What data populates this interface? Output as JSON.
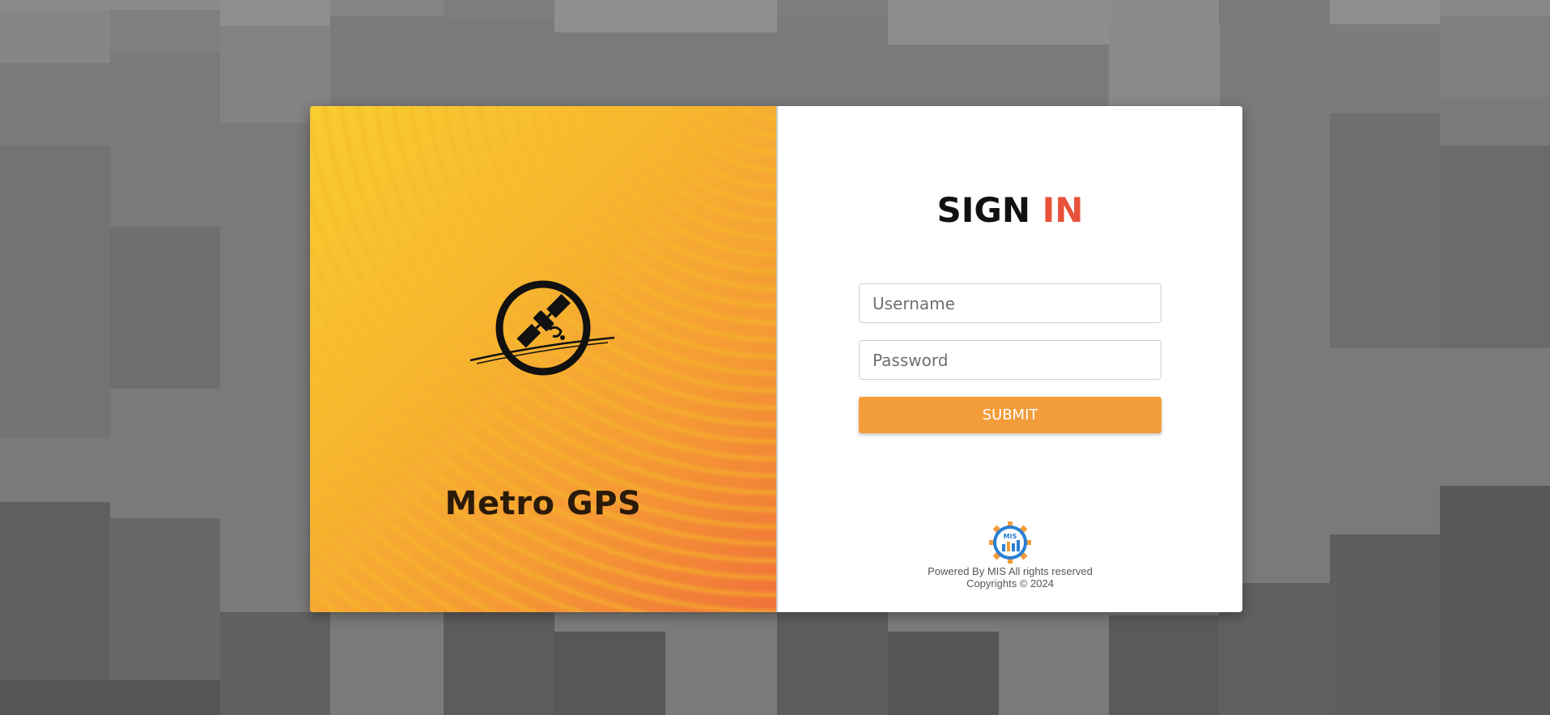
{
  "brand": {
    "name": "Metro GPS",
    "logo_icon": "satellite-icon"
  },
  "signin": {
    "title_part1": "SIGN",
    "title_part2": "IN",
    "username_placeholder": "Username",
    "password_placeholder": "Password",
    "submit_label": "SUBMIT"
  },
  "footer": {
    "logo_text": "MIS",
    "powered_by": "Powered By MIS All rights reserved",
    "copyright": "Copyrights © 2024"
  },
  "colors": {
    "accent": "#e9523a",
    "button": "#f39c3a",
    "background": "#7a7a7a"
  }
}
